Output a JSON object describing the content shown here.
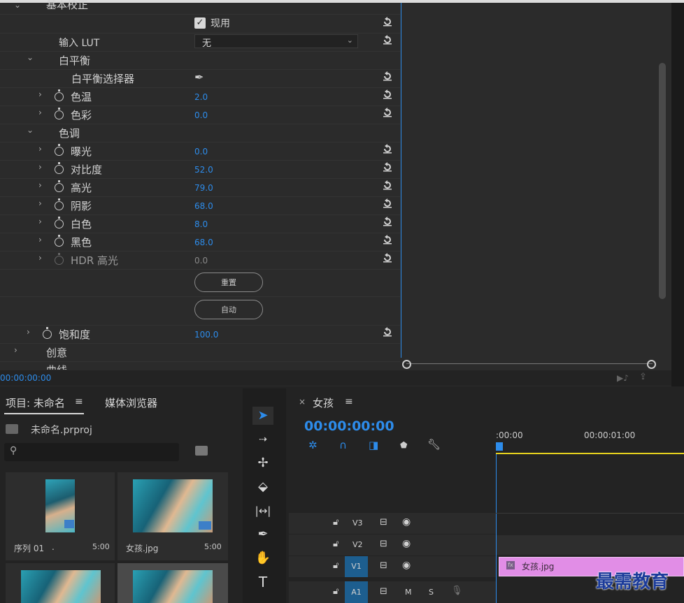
{
  "effect_controls": {
    "section_basic": "基本校正",
    "apply_label": "现用",
    "input_lut_label": "输入 LUT",
    "input_lut_value": "无",
    "white_balance": "白平衡",
    "wb_selector": "白平衡选择器",
    "params": [
      {
        "label": "色温",
        "value": "2.0"
      },
      {
        "label": "色彩",
        "value": "0.0"
      }
    ],
    "tone": "色调",
    "tone_params": [
      {
        "label": "曝光",
        "value": "0.0"
      },
      {
        "label": "对比度",
        "value": "52.0"
      },
      {
        "label": "高光",
        "value": "79.0"
      },
      {
        "label": "阴影",
        "value": "68.0"
      },
      {
        "label": "白色",
        "value": "8.0"
      },
      {
        "label": "黑色",
        "value": "68.0"
      },
      {
        "label": "HDR 高光",
        "value": "0.0"
      }
    ],
    "reset_button": "重置",
    "auto_button": "自动",
    "saturation_label": "饱和度",
    "saturation_value": "100.0",
    "creative": "创意",
    "curves": "曲线",
    "timecode": "00:00:00:00"
  },
  "project": {
    "tab_project": "项目: 未命名",
    "tab_media": "媒体浏览器",
    "file_name": "未命名.prproj",
    "items": [
      {
        "name": "序列 01",
        "dot": ".",
        "duration": "5:00"
      },
      {
        "name": "女孩.jpg",
        "duration": "5:00"
      }
    ]
  },
  "timeline": {
    "tab_label": "女孩",
    "timecode": "00:00:00:00",
    "ruler": [
      ":00:00",
      "00:00:01:00"
    ],
    "tracks": [
      "V3",
      "V2",
      "V1",
      "A1"
    ],
    "track_buttons": {
      "mute": "M",
      "solo": "S"
    },
    "clip_label": "女孩.jpg",
    "fx_badge": "fx"
  },
  "watermark": "最需教育",
  "colors": {
    "accent": "#2d8ceb",
    "clip": "#e18de6",
    "playhead_bar": "#e6d21e"
  }
}
